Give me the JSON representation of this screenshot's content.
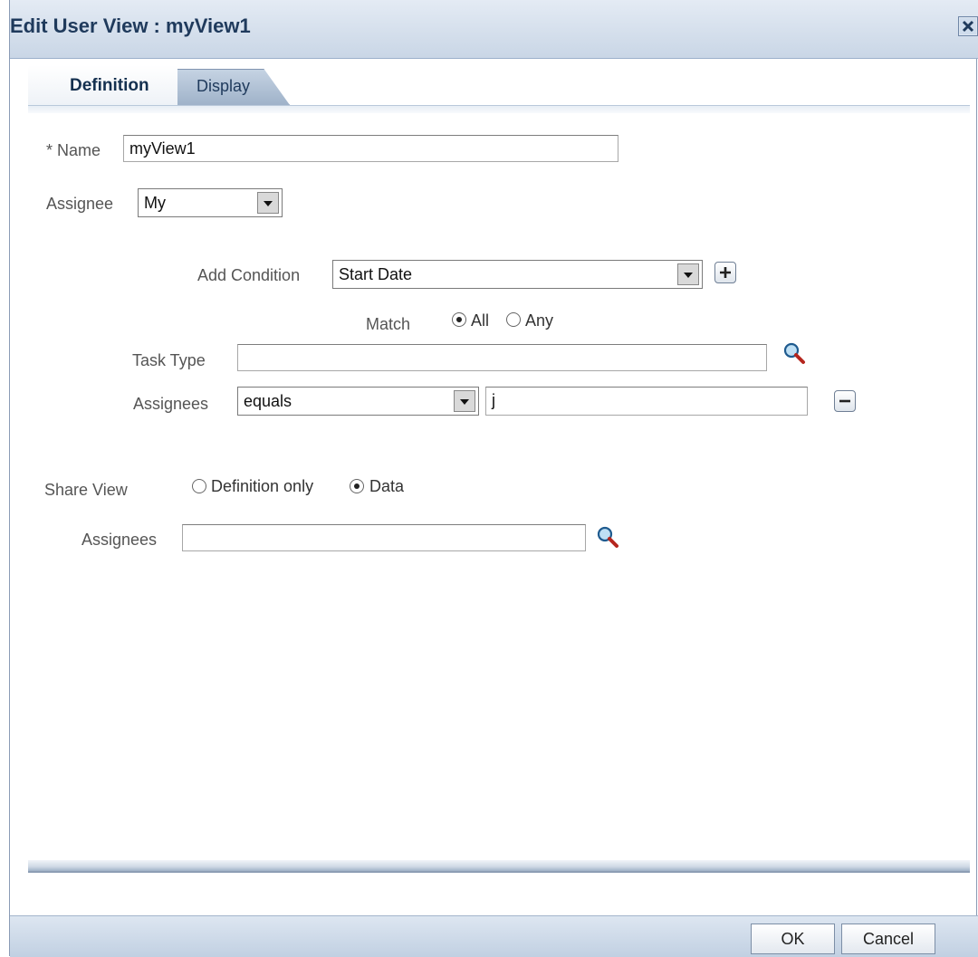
{
  "dialog": {
    "title": "Edit User View : myView1"
  },
  "tabs": [
    {
      "label": "Definition",
      "selected": true
    },
    {
      "label": "Display",
      "selected": false
    }
  ],
  "form": {
    "name_label": "* Name",
    "name_value": "myView1",
    "assignee_label": "Assignee",
    "assignee_value": "My",
    "add_condition_label": "Add Condition",
    "add_condition_value": "Start Date",
    "match_label": "Match",
    "match_options": [
      "All",
      "Any"
    ],
    "match_selected": "All",
    "task_type_label": "Task Type",
    "task_type_value": "",
    "assignees_cond_label": "Assignees",
    "assignees_operator": "equals",
    "assignees_cond_value": "j",
    "share_view_label": "Share View",
    "share_options": [
      "Definition only",
      "Data"
    ],
    "share_selected": "Data",
    "share_assignees_label": "Assignees",
    "share_assignees_value": ""
  },
  "buttons": {
    "ok": "OK",
    "cancel": "Cancel"
  },
  "icons": {
    "close": "close-icon",
    "add": "plus-icon",
    "remove": "minus-icon",
    "search": "magnifier-icon",
    "dropdown": "chevron-down-icon"
  },
  "colors": {
    "title_text": "#1f3a5c",
    "header_bg": "#c9d6e6",
    "border": "#8a9bb5"
  }
}
